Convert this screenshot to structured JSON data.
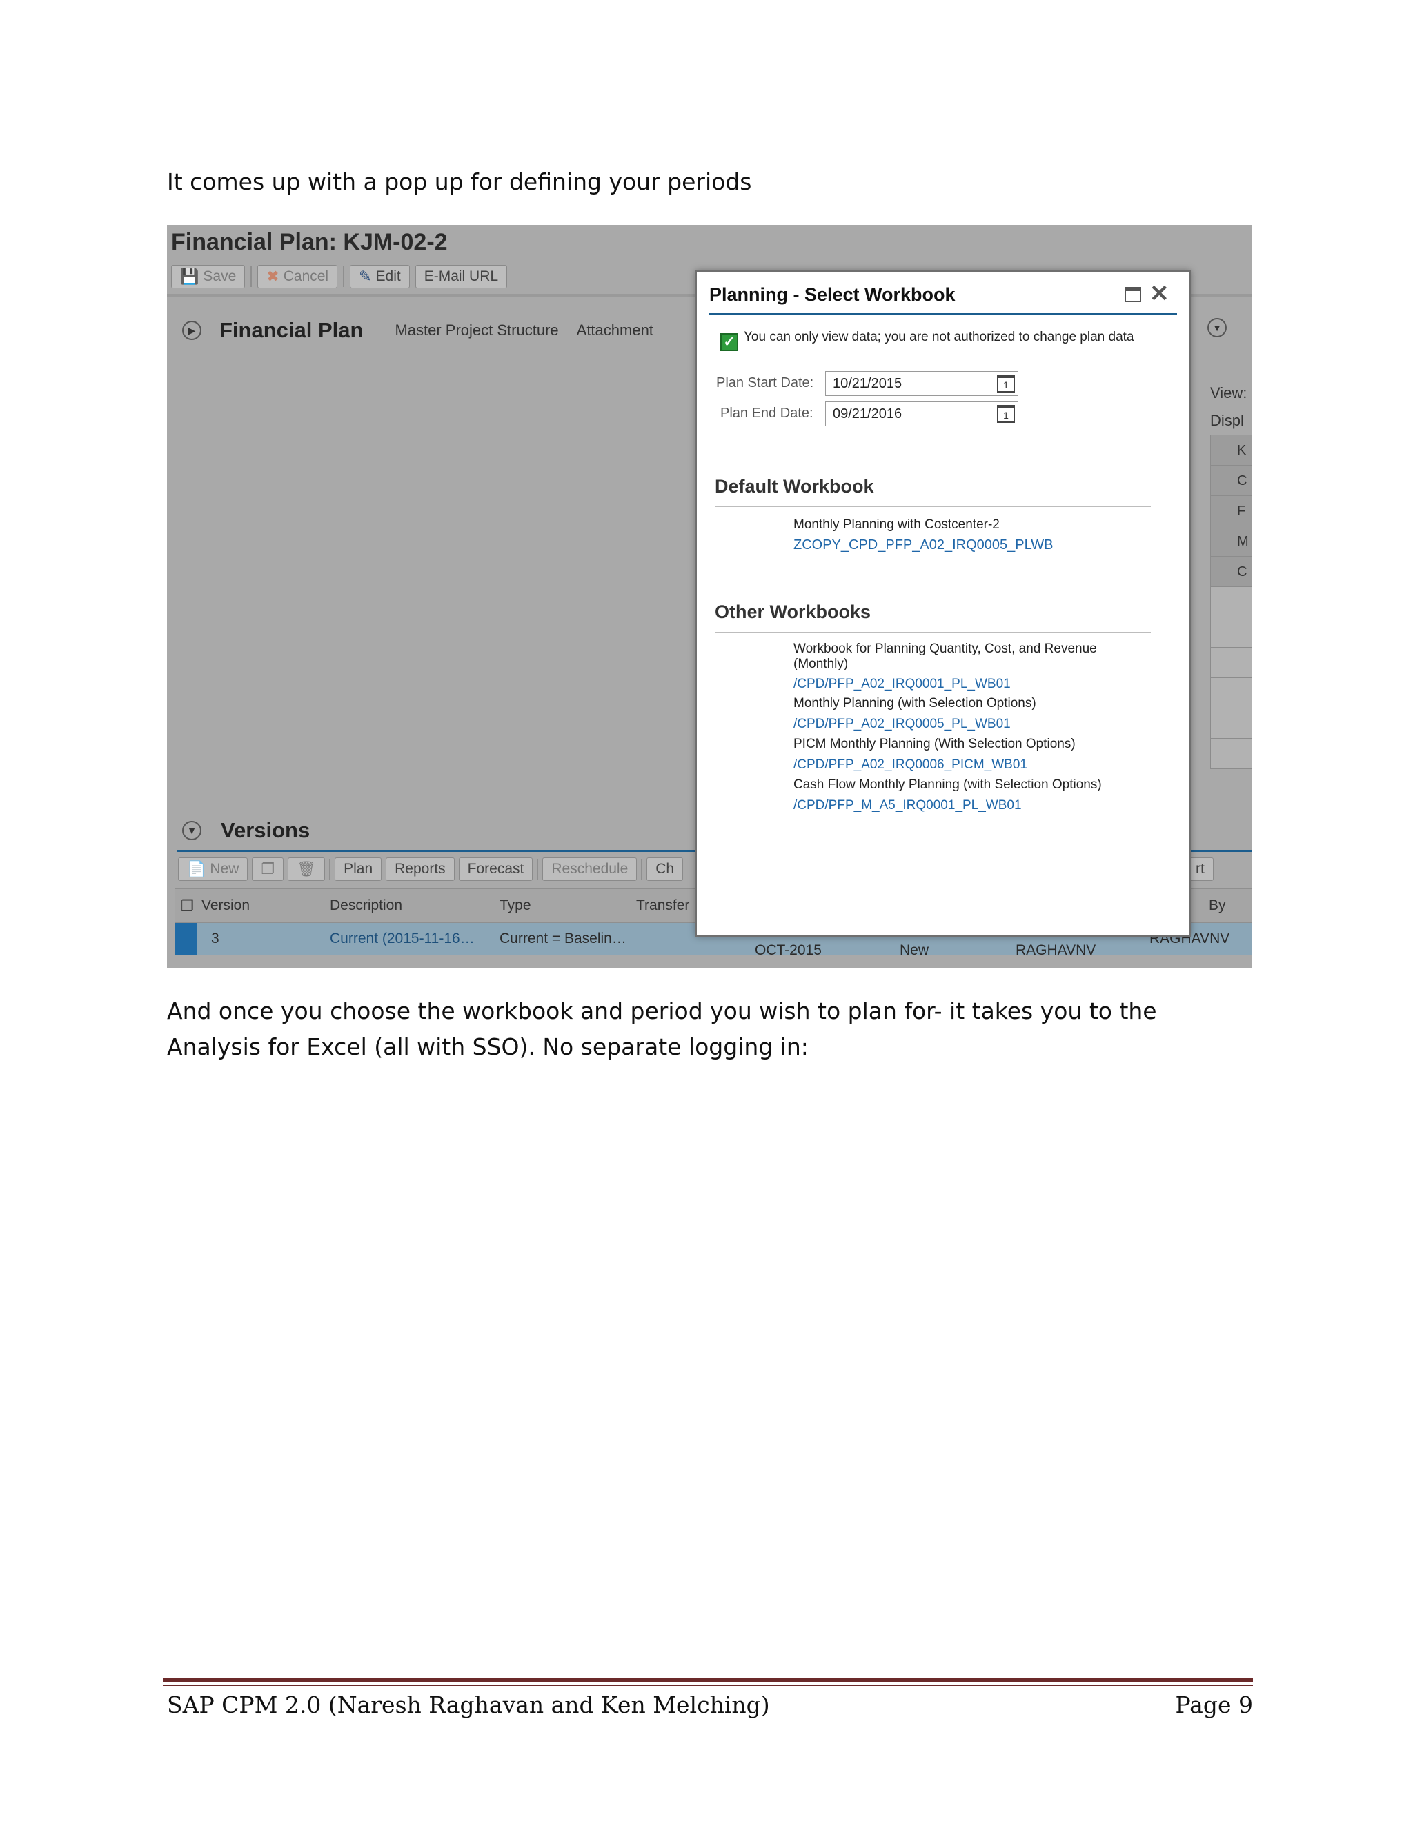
{
  "intro": "It comes up with a pop up for defining your periods",
  "outro": "And once you choose the workbook and period you wish to plan for- it takes you to the Analysis for Excel (all with SSO). No separate logging in:",
  "screenshot": {
    "page_title": "Financial Plan: KJM-02-2",
    "toolbar": {
      "save": "Save",
      "cancel": "Cancel",
      "edit": "Edit",
      "email": "E-Mail URL"
    },
    "tabs": {
      "financial_plan": "Financial Plan",
      "master_project_structure": "Master Project Structure",
      "attachment": "Attachment"
    },
    "right_panel": {
      "view": "View:",
      "display": "Displ",
      "cells": [
        "K",
        "C",
        "F",
        "M",
        "C"
      ]
    },
    "versions": {
      "title": "Versions",
      "toolbar": {
        "new": "New",
        "plan": "Plan",
        "reports": "Reports",
        "forecast": "Forecast",
        "reschedule": "Reschedule",
        "change": "Ch",
        "sort": "rt"
      },
      "columns": {
        "version": "Version",
        "description": "Description",
        "type": "Type",
        "transfer": "Transfer",
        "by": "By"
      },
      "row1": {
        "version": "3",
        "description": "Current (2015-11-16…",
        "type": "Current = Baselin…",
        "period": "OCT-2015",
        "status": "New",
        "created_by": "RAGHAVNV",
        "changed_by": "RAGHAVNV"
      }
    }
  },
  "dialog": {
    "title": "Planning - Select Workbook",
    "message": "You can only view data; you are not authorized to change plan data",
    "start_label": "Plan Start Date:",
    "start_value": "10/21/2015",
    "end_label": "Plan End Date:",
    "end_value": "09/21/2016",
    "default_title": "Default Workbook",
    "default_desc": "Monthly Planning with Costcenter-2",
    "default_link": "ZCOPY_CPD_PFP_A02_IRQ0005_PLWB",
    "other_title": "Other Workbooks",
    "other": [
      {
        "desc": "Workbook for Planning Quantity, Cost, and Revenue (Monthly)",
        "link": "/CPD/PFP_A02_IRQ0001_PL_WB01"
      },
      {
        "desc": "Monthly Planning  (with Selection Options)",
        "link": "/CPD/PFP_A02_IRQ0005_PL_WB01"
      },
      {
        "desc": "PICM Monthly Planning (With Selection Options)",
        "link": "/CPD/PFP_A02_IRQ0006_PICM_WB01"
      },
      {
        "desc": "Cash Flow Monthly Planning (with Selection Options)",
        "link": "/CPD/PFP_M_A5_IRQ0001_PL_WB01"
      }
    ]
  },
  "footer": {
    "left": "SAP CPM 2.0 (Naresh Raghavan and Ken Melching)",
    "right": "Page 9"
  },
  "colors": {
    "selection": "#1f6aa5",
    "link": "#2067a9",
    "footer_rule": "#6b2a2a"
  }
}
